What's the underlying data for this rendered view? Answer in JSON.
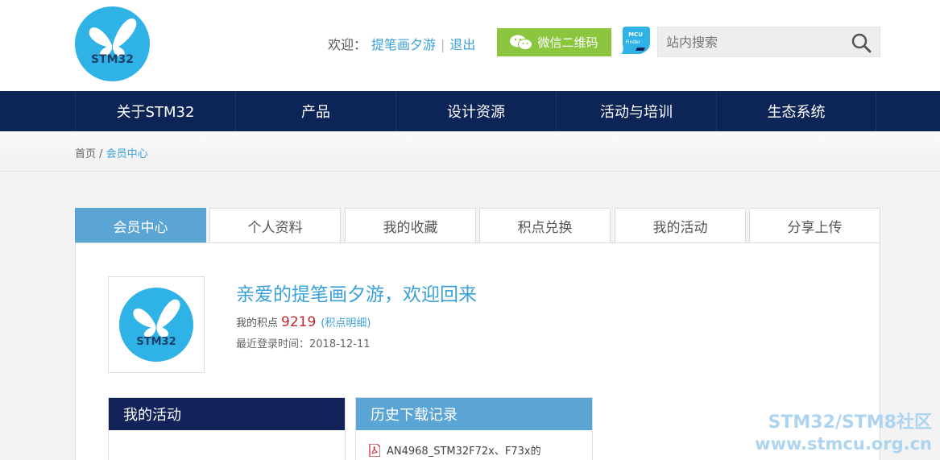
{
  "header": {
    "logo_text": "STM32",
    "welcome_prefix": "欢迎：",
    "username": "提笔画夕游",
    "separator": "|",
    "logout": "退出",
    "wechat_label": "微信二维码",
    "mcu_finder_label": "MCU Finder",
    "search_placeholder": "站内搜索"
  },
  "nav": {
    "items": [
      "关于STM32",
      "产品",
      "设计资源",
      "活动与培训",
      "生态系统"
    ]
  },
  "breadcrumb": {
    "home": "首页",
    "sep": " / ",
    "current": "会员中心"
  },
  "tabs": [
    "会员中心",
    "个人资料",
    "我的收藏",
    "积点兑换",
    "我的活动",
    "分享上传"
  ],
  "profile": {
    "avatar_text": "STM32",
    "greeting": "亲爱的提笔画夕游，欢迎回来",
    "points_label": "我的积点",
    "points_value": "9219",
    "points_detail": "(积点明细)",
    "last_login": "最近登录时间：2018-12-11"
  },
  "boxes": {
    "activity_title": "我的活动",
    "download_title": "历史下载记录",
    "download_items": [
      "AN4968_STM32F72x、F73x的"
    ]
  },
  "watermark": {
    "line1": "STM32/STM8社区",
    "line2": "www.stmcu.org.cn"
  },
  "colors": {
    "brand_blue": "#2fb3e6",
    "nav_navy": "#0d2456",
    "tab_active": "#5aa5d4",
    "wechat_green": "#8cc63f",
    "points_red": "#c0272d"
  }
}
